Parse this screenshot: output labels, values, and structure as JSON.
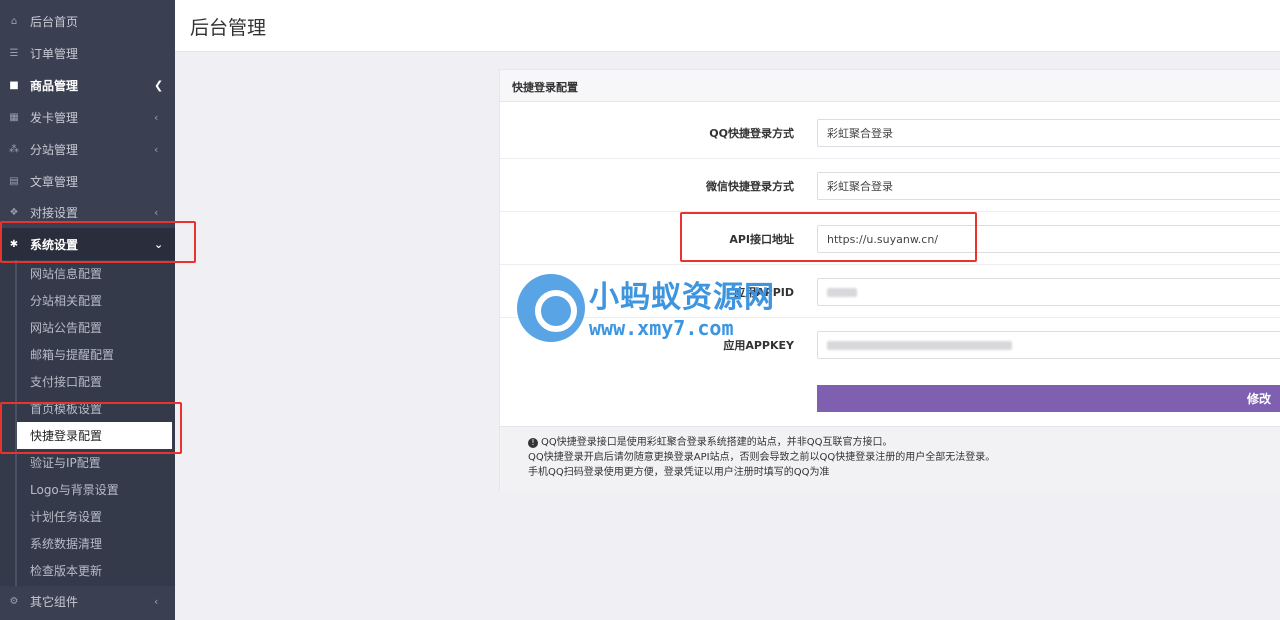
{
  "sidebar": {
    "items": [
      {
        "label": "后台首页",
        "icon": "home-icon"
      },
      {
        "label": "订单管理",
        "icon": "list-icon"
      },
      {
        "label": "商品管理",
        "icon": "cart-icon"
      },
      {
        "label": "发卡管理",
        "icon": "grid-icon"
      },
      {
        "label": "分站管理",
        "icon": "sitemap-icon"
      },
      {
        "label": "文章管理",
        "icon": "book-icon"
      },
      {
        "label": "对接设置",
        "icon": "cubes-icon"
      },
      {
        "label": "系统设置",
        "icon": "gear-icon"
      },
      {
        "label": "其它组件",
        "icon": "gears-icon"
      }
    ],
    "submenu": [
      "网站信息配置",
      "分站相关配置",
      "网站公告配置",
      "邮箱与提醒配置",
      "支付接口配置",
      "首页模板设置",
      "快捷登录配置",
      "验证与IP配置",
      "Logo与背景设置",
      "计划任务设置",
      "系统数据清理",
      "检查版本更新"
    ]
  },
  "header": {
    "title": "后台管理"
  },
  "panel": {
    "title": "快捷登录配置",
    "fields": [
      {
        "label": "QQ快捷登录方式",
        "value": "彩虹聚合登录"
      },
      {
        "label": "微信快捷登录方式",
        "value": "彩虹聚合登录"
      },
      {
        "label": "API接口地址",
        "value": "https://u.suyanw.cn/"
      },
      {
        "label": "应用APPID",
        "value": ""
      },
      {
        "label": "应用APPKEY",
        "value": ""
      }
    ],
    "submit_label": "修改",
    "notes": [
      "QQ快捷登录接口是使用彩虹聚合登录系统搭建的站点，并非QQ互联官方接口。",
      "QQ快捷登录开启后请勿随意更换登录API站点，否则会导致之前以QQ快捷登录注册的用户全部无法登录。",
      "手机QQ扫码登录使用更方便，登录凭证以用户注册时填写的QQ为准"
    ]
  },
  "watermark": {
    "name": "小蚂蚁资源网",
    "url": "www.xmy7.com"
  },
  "colors": {
    "sidebar_bg": "#3a3f51",
    "accent_button": "#7e5fb0",
    "highlight": "#e8332f",
    "watermark": "#3d95e0"
  }
}
